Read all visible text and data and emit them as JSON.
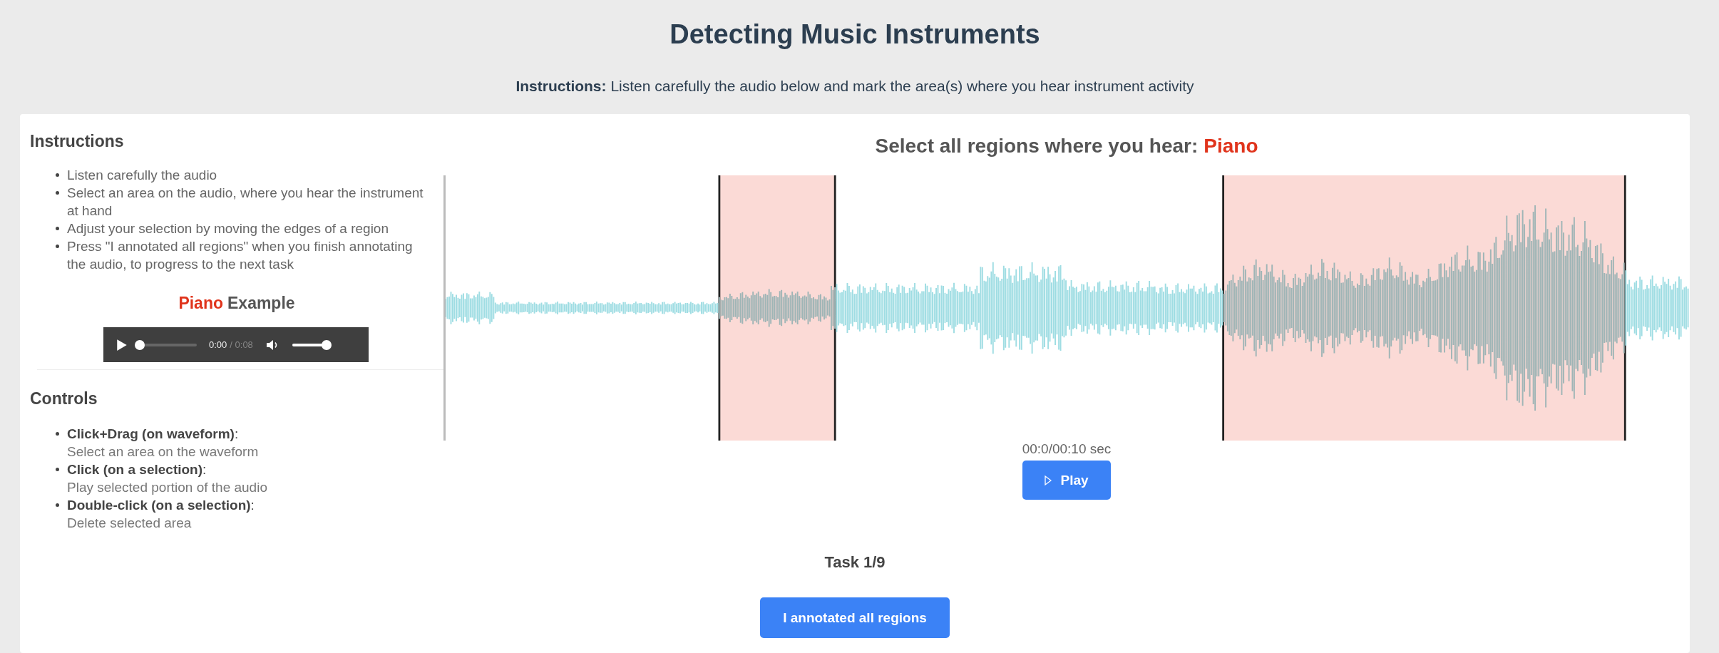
{
  "header": {
    "title": "Detecting Music Instruments",
    "instructions": "**Instructions:** Listen carefully the audio below and mark the area(s) where you hear instrument activity"
  },
  "sidebar": {
    "instructions_heading": "Instructions",
    "instructions": [
      "Listen carefully the audio",
      "Select an area on the audio, where you hear the instrument at hand",
      "Adjust your selection by moving the edges of a region",
      "Press \"I annotated all regions\" when you finish annotating the audio, to progress to the next task"
    ],
    "example": {
      "instrument": "Piano",
      "label": "Example"
    },
    "player": {
      "time": "0:00",
      "duration": "/ 0:08",
      "progress": {
        "level": 0
      },
      "volume": {
        "level": 1
      }
    },
    "controls_heading": "Controls",
    "controls": [
      {
        "action": "**Click+Drag (on waveform)**:",
        "description": "Select an area on the waveform"
      },
      {
        "action": "**Click (on a selection)**:",
        "description": "Play selected portion of the audio"
      },
      {
        "action": "**Double-click (on a selection)**:",
        "description": "Delete selected area"
      }
    ]
  },
  "annotator": {
    "prompt": "Select all regions where you hear:",
    "instrument": "Piano",
    "time": "00:0/00:10 sec",
    "play_button": "Play"
  },
  "task": "Task 1/9",
  "submit_button": "I annotated all regions"
}
